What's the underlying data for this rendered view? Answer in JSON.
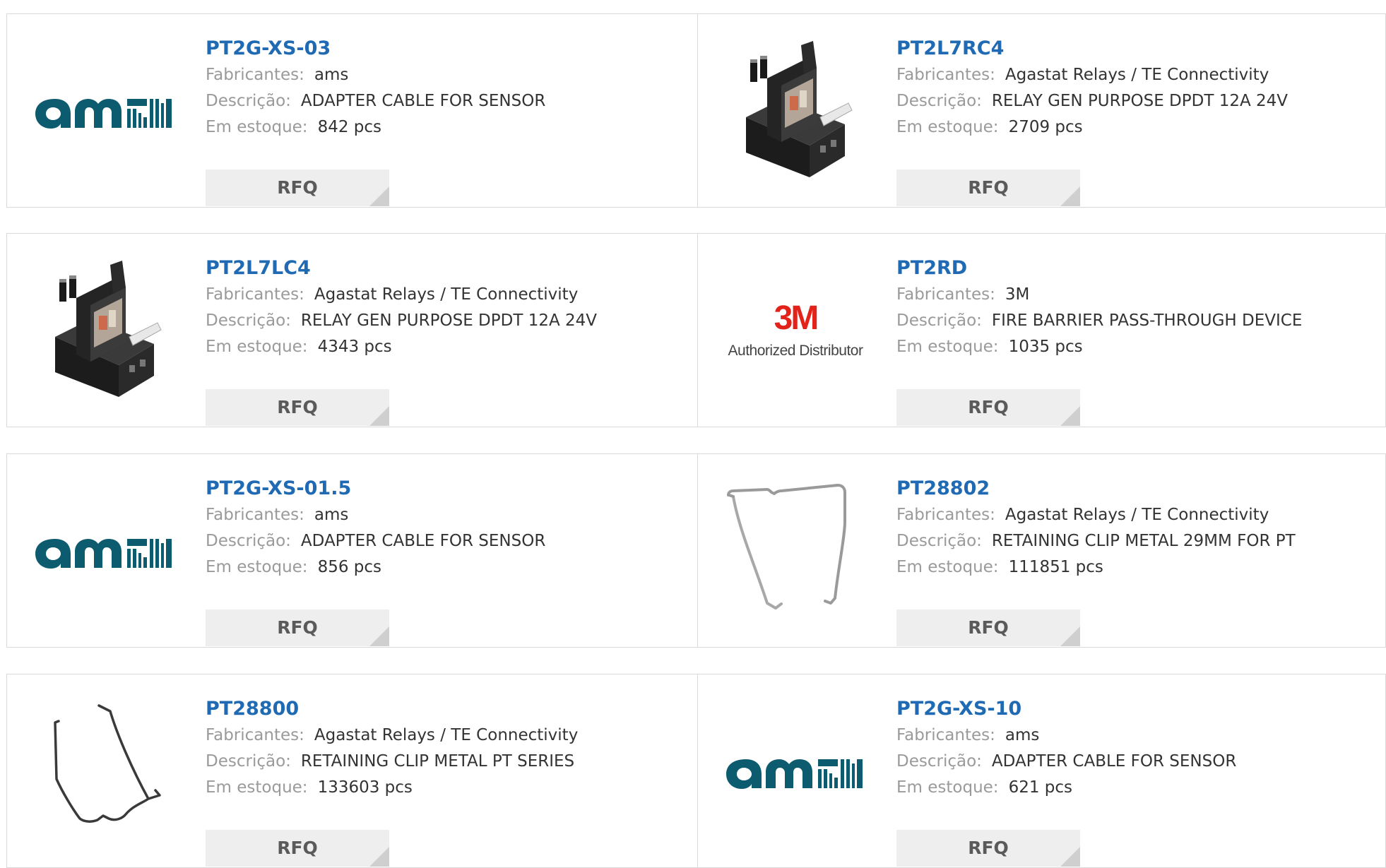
{
  "labels": {
    "manufacturer": "Fabricantes:",
    "description": "Descrição:",
    "stock": "Em estoque:",
    "rfq": "RFQ"
  },
  "colors": {
    "part_link": "#1f6ab3",
    "label": "#9a9a9a",
    "value": "#333333",
    "ams_brand": "#0d5b6e",
    "brand_3m": "#e2231a"
  },
  "logos": {
    "ams": "ams",
    "brand_3m": {
      "mark": "3M",
      "caption": "Authorized Distributor"
    }
  },
  "products": [
    {
      "part": "PT2G-XS-03",
      "manufacturer": "ams",
      "description": "ADAPTER CABLE FOR SENSOR",
      "stock": "842 pcs",
      "image": "ams-logo"
    },
    {
      "part": "PT2L7RC4",
      "manufacturer": "Agastat Relays / TE Connectivity",
      "description": "RELAY GEN PURPOSE DPDT 12A 24V",
      "stock": "2709 pcs",
      "image": "relay-photo"
    },
    {
      "part": "PT2L7LC4",
      "manufacturer": "Agastat Relays / TE Connectivity",
      "description": "RELAY GEN PURPOSE DPDT 12A 24V",
      "stock": "4343 pcs",
      "image": "relay-photo"
    },
    {
      "part": "PT2RD",
      "manufacturer": "3M",
      "description": "FIRE BARRIER PASS-THROUGH DEVICE",
      "stock": "1035 pcs",
      "image": "3m-logo"
    },
    {
      "part": "PT2G-XS-01.5",
      "manufacturer": "ams",
      "description": "ADAPTER CABLE FOR SENSOR",
      "stock": "856 pcs",
      "image": "ams-logo"
    },
    {
      "part": "PT28802",
      "manufacturer": "Agastat Relays / TE Connectivity",
      "description": "RETAINING CLIP METAL 29MM FOR PT",
      "stock": "111851 pcs",
      "image": "clip-photo-a"
    },
    {
      "part": "PT28800",
      "manufacturer": "Agastat Relays / TE Connectivity",
      "description": "RETAINING CLIP METAL PT SERIES",
      "stock": "133603 pcs",
      "image": "clip-photo-b"
    },
    {
      "part": "PT2G-XS-10",
      "manufacturer": "ams",
      "description": "ADAPTER CABLE FOR SENSOR",
      "stock": "621 pcs",
      "image": "ams-logo"
    }
  ]
}
